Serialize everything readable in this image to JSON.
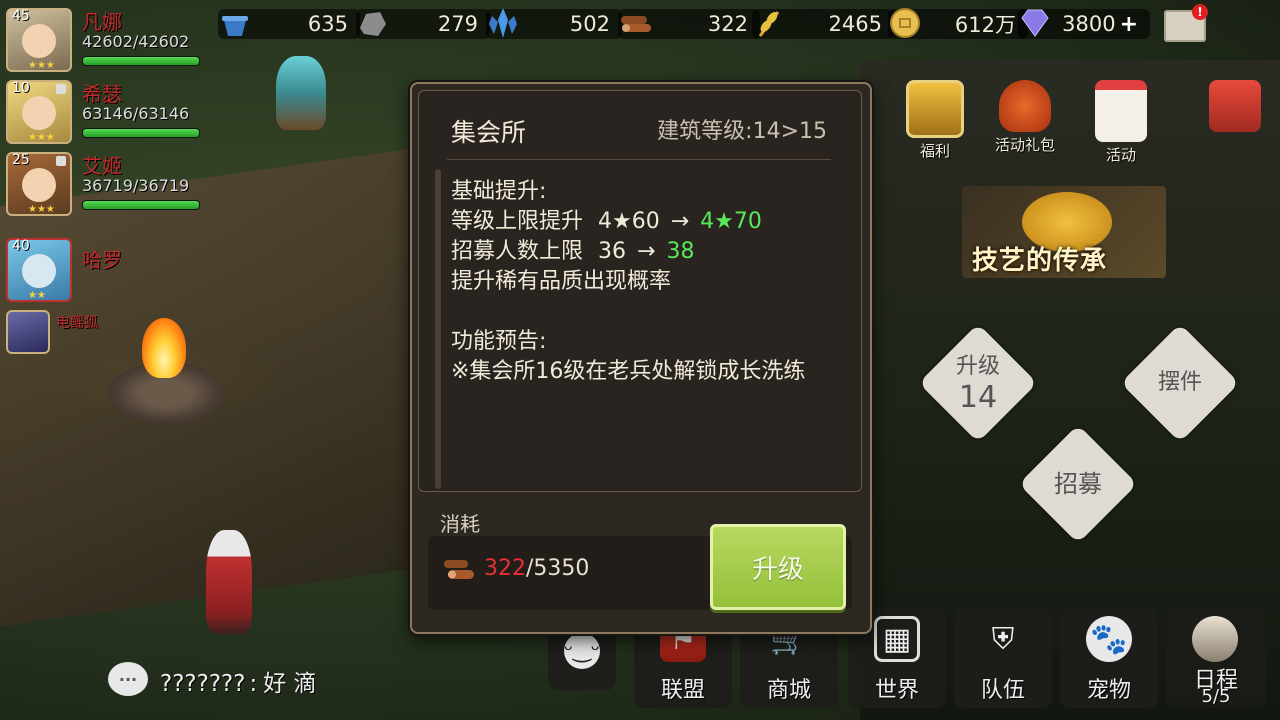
{
  "resources": [
    {
      "icon": "pot-icon",
      "value": "635"
    },
    {
      "icon": "stone-icon",
      "value": "279"
    },
    {
      "icon": "crystal-icon",
      "value": "502"
    },
    {
      "icon": "wood-icon",
      "value": "322"
    },
    {
      "icon": "wheat-icon",
      "value": "2465"
    },
    {
      "icon": "coin-icon",
      "value": "612万"
    },
    {
      "icon": "diamond-icon",
      "value": "3800"
    }
  ],
  "mail_badge": "!",
  "heroes": [
    {
      "level": "45",
      "name": "凡娜",
      "hp": "42602/42602",
      "hp_fraction": 1.0
    },
    {
      "level": "10",
      "name": "希瑟",
      "hp": "63146/63146",
      "hp_fraction": 1.0
    },
    {
      "level": "25",
      "name": "艾姬",
      "hp": "36719/36719",
      "hp_fraction": 1.0
    },
    {
      "level": "40",
      "name": "哈罗",
      "hp": "",
      "hp_fraction": null
    },
    {
      "level": "",
      "name": "电鳐狐",
      "hp": "",
      "hp_fraction": null
    }
  ],
  "right_icons": [
    {
      "label": "福利"
    },
    {
      "label": "活动礼包"
    },
    {
      "label": "活动"
    }
  ],
  "event_banner": "技艺的传承",
  "diamond_buttons": {
    "upgrade": {
      "label": "升级",
      "value": "14"
    },
    "decor": {
      "label": "摆件"
    },
    "recruit": {
      "label": "招募"
    }
  },
  "bottom_nav": [
    {
      "label": "联盟"
    },
    {
      "label": "商城"
    },
    {
      "label": "世界"
    },
    {
      "label": "队伍"
    },
    {
      "label": "宠物"
    },
    {
      "label": "日程",
      "sub": "5/5"
    }
  ],
  "chat": {
    "sender": "???????",
    "separator": ":",
    "message": "好 滴"
  },
  "dialog": {
    "title": "集会所",
    "building_level": "建筑等级:14>15",
    "section1_title": "基础提升:",
    "line1_label": "等级上限提升",
    "line1_from": "4★60",
    "line1_arrow": "→",
    "line1_to": "4★70",
    "line2_label": "招募人数上限",
    "line2_from": "36",
    "line2_arrow": "→",
    "line2_to": "38",
    "line3": "提升稀有品质出现概率",
    "section2_title": "功能预告:",
    "notice": "※集会所16级在老兵处解锁成长洗练",
    "cost_label": "消耗",
    "cost_have": "322",
    "cost_sep": "/",
    "cost_need": "5350",
    "upgrade_button": "升级"
  }
}
